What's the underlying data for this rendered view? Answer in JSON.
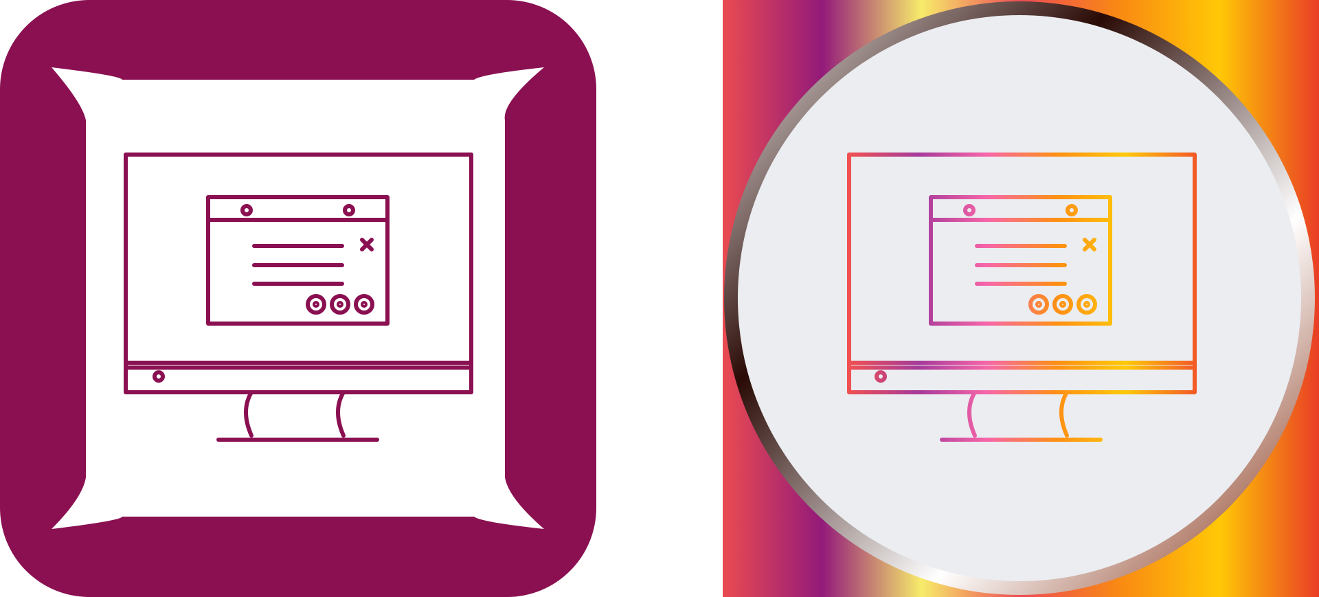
{
  "icons": [
    {
      "id": "computer-icon-glyph",
      "style": "glyph",
      "colors": {
        "background": "#8a1051",
        "pillow": "#ffffff",
        "stroke": "#8a1051"
      }
    },
    {
      "id": "computer-icon-gradient",
      "style": "gradient",
      "colors": {
        "background_stops": [
          "#ea4b51",
          "#931a7a",
          "#f7eb6b",
          "#ed4c55",
          "#f98a12",
          "#ffc806",
          "#e93d25"
        ],
        "ring_stops": [
          "#ffffff",
          "#2a0a05",
          "#ffffff",
          "#7a1f00"
        ],
        "circle_fill": "#ebedf1",
        "stroke_stops": [
          "#f05052",
          "#a63a9a",
          "#f766a8",
          "#ff8f14",
          "#ffc90a",
          "#f35a25"
        ]
      }
    }
  ]
}
